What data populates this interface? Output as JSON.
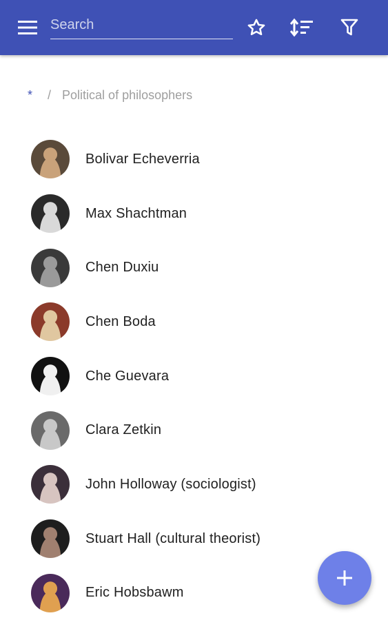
{
  "toolbar": {
    "menu_icon": "menu-icon",
    "search_placeholder": "Search",
    "search_value": "",
    "favorite_icon": "star-outline-icon",
    "sort_icon": "sort-icon",
    "filter_icon": "filter-icon"
  },
  "breadcrumb": {
    "root": "*",
    "separator": "/",
    "current": "Political of philosophers"
  },
  "list": {
    "items": [
      {
        "name": "Bolivar Echeverria",
        "avatar_colors": [
          "#5a4a3a",
          "#c9a27a"
        ]
      },
      {
        "name": "Max Shachtman",
        "avatar_colors": [
          "#2a2a2a",
          "#d9d9d9"
        ]
      },
      {
        "name": "Chen Duxiu",
        "avatar_colors": [
          "#3a3a3a",
          "#9a9a9a"
        ]
      },
      {
        "name": "Chen Boda",
        "avatar_colors": [
          "#8b3a2a",
          "#e0c7a0"
        ]
      },
      {
        "name": "Che Guevara",
        "avatar_colors": [
          "#111111",
          "#f0f0f0"
        ]
      },
      {
        "name": "Clara Zetkin",
        "avatar_colors": [
          "#6a6a6a",
          "#c8c8c8"
        ]
      },
      {
        "name": "John Holloway (sociologist)",
        "avatar_colors": [
          "#3b2f3a",
          "#d7c4c0"
        ]
      },
      {
        "name": "Stuart Hall (cultural theorist)",
        "avatar_colors": [
          "#1e1e1e",
          "#a08070"
        ]
      },
      {
        "name": "Eric Hobsbawm",
        "avatar_colors": [
          "#4a2a5a",
          "#e0a050"
        ]
      }
    ]
  },
  "fab": {
    "icon": "plus-icon"
  },
  "colors": {
    "primary": "#3f51b5",
    "fab": "#6e80e8",
    "text": "#212121",
    "muted": "#9e9e9e"
  }
}
